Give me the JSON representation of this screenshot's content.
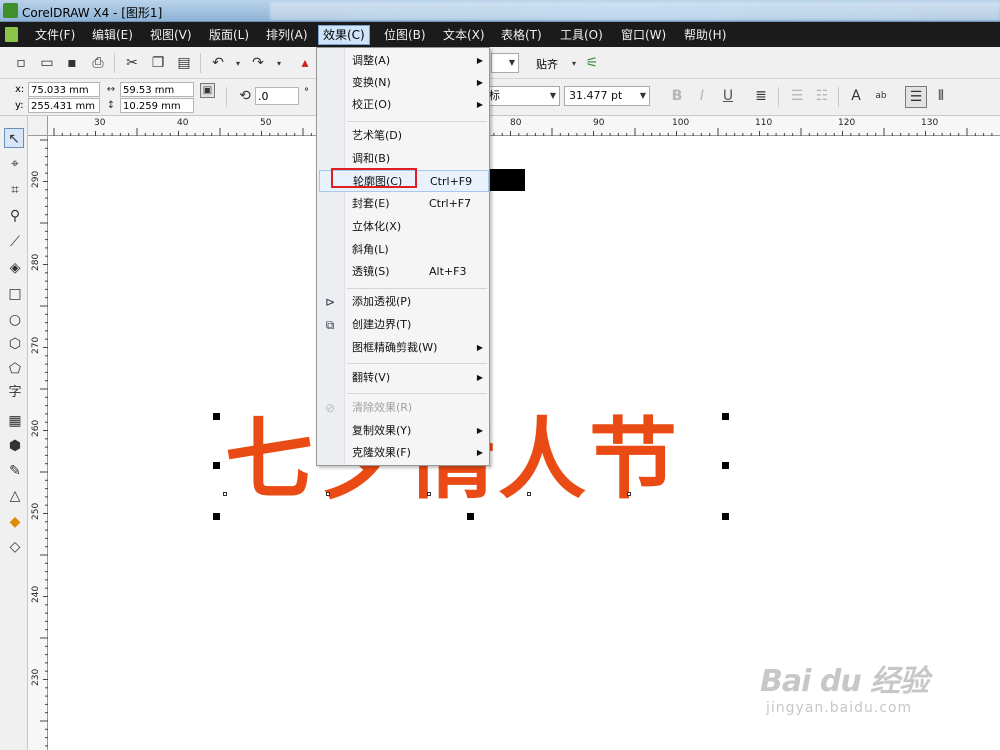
{
  "window": {
    "title": "CorelDRAW X4 - [图形1]"
  },
  "menubar": {
    "items": [
      "文件(F)",
      "编辑(E)",
      "视图(V)",
      "版面(L)",
      "排列(A)",
      "效果(C)",
      "位图(B)",
      "文本(X)",
      "表格(T)",
      "工具(O)",
      "窗口(W)",
      "帮助(H)"
    ],
    "active": "效果(C)"
  },
  "toolbar": {
    "snap_label": "贴齐",
    "position": {
      "x": "75.033 mm",
      "y": "255.431 mm",
      "x_label": "x:",
      "y_label": "y:"
    },
    "size": {
      "w": "59.53 mm",
      "h": "10.259 mm"
    },
    "rotation": ".0",
    "font_name_partial": "标",
    "font_size": "31.477 pt"
  },
  "ruler": {
    "x_labels": [
      "30",
      "40",
      "50",
      "80",
      "90",
      "100",
      "110",
      "120",
      "130"
    ],
    "y_labels": [
      "290",
      "280",
      "270",
      "260",
      "250",
      "240",
      "230"
    ]
  },
  "canvas": {
    "text": "七夕情人节",
    "text_color": "#ea4a13"
  },
  "effects_menu": {
    "items": [
      {
        "label": "调整(A)",
        "submenu": true
      },
      {
        "label": "变换(N)",
        "submenu": true
      },
      {
        "label": "校正(O)",
        "submenu": true
      },
      {
        "label": "艺术笔(D)"
      },
      {
        "label": "调和(B)"
      },
      {
        "label": "轮廓图(C)",
        "shortcut": "Ctrl+F9"
      },
      {
        "label": "封套(E)",
        "shortcut": "Ctrl+F7"
      },
      {
        "label": "立体化(X)"
      },
      {
        "label": "斜角(L)"
      },
      {
        "label": "透镜(S)",
        "shortcut": "Alt+F3"
      },
      {
        "label": "添加透视(P)",
        "icon": "perspective-icon"
      },
      {
        "label": "创建边界(T)",
        "icon": "boundary-icon"
      },
      {
        "label": "图框精确剪裁(W)",
        "submenu": true
      },
      {
        "label": "翻转(V)",
        "submenu": true
      },
      {
        "label": "清除效果(R)",
        "disabled": true,
        "icon": "clear-effect-icon"
      },
      {
        "label": "复制效果(Y)",
        "submenu": true
      },
      {
        "label": "克隆效果(F)",
        "submenu": true
      }
    ],
    "highlighted": "轮廓图(C)"
  },
  "watermark": {
    "brand": "Bai du 经验",
    "url": "jingyan.baidu.com"
  }
}
